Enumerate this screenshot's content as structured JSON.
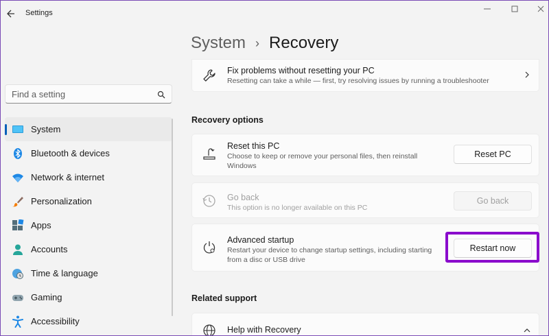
{
  "window": {
    "title": "Settings"
  },
  "search": {
    "placeholder": "Find a setting"
  },
  "sidebar": {
    "items": [
      {
        "label": "System",
        "icon": "system-icon",
        "active": true
      },
      {
        "label": "Bluetooth & devices",
        "icon": "bluetooth-icon"
      },
      {
        "label": "Network & internet",
        "icon": "wifi-icon"
      },
      {
        "label": "Personalization",
        "icon": "brush-icon"
      },
      {
        "label": "Apps",
        "icon": "apps-icon"
      },
      {
        "label": "Accounts",
        "icon": "person-icon"
      },
      {
        "label": "Time & language",
        "icon": "globe-clock-icon"
      },
      {
        "label": "Gaming",
        "icon": "gamepad-icon"
      },
      {
        "label": "Accessibility",
        "icon": "accessibility-icon"
      }
    ]
  },
  "breadcrumb": {
    "parent": "System",
    "separator": "›",
    "current": "Recovery"
  },
  "fix_card": {
    "title": "Fix problems without resetting your PC",
    "desc": "Resetting can take a while — first, try resolving issues by running a troubleshooter"
  },
  "recovery_options": {
    "heading": "Recovery options",
    "reset": {
      "title": "Reset this PC",
      "desc_line1": "Choose to keep or remove your personal files, then reinstall",
      "desc_line2": "Windows",
      "button": "Reset PC"
    },
    "goback": {
      "title": "Go back",
      "desc": "This option is no longer available on this PC",
      "button": "Go back"
    },
    "advanced": {
      "title": "Advanced startup",
      "desc_line1": "Restart your device to change startup settings, including starting",
      "desc_line2": "from a disc or USB drive",
      "button": "Restart now"
    }
  },
  "related_support": {
    "heading": "Related support",
    "help": {
      "title": "Help with Recovery"
    }
  },
  "colors": {
    "accent": "#005fb8",
    "highlight": "#8a0ccc"
  }
}
